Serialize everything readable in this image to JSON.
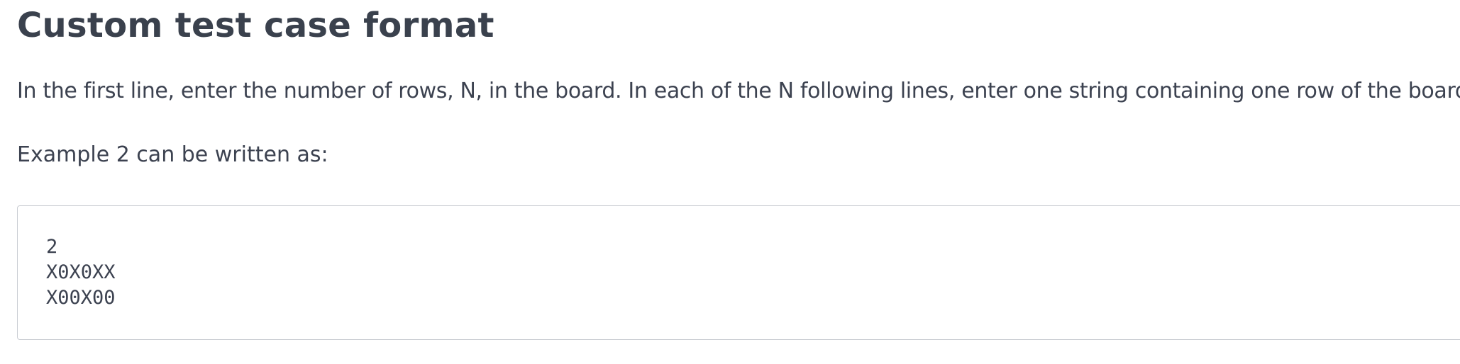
{
  "header": {
    "title": "Custom test case format"
  },
  "content": {
    "paragraph_1": "In the first line, enter the number of rows, N, in the board. In each of the N following lines, enter one string containing one row of the board.",
    "paragraph_2": "Example 2 can be written as:"
  },
  "code_example": {
    "lines": [
      "2",
      "X0X0XX",
      "X00X00"
    ]
  }
}
